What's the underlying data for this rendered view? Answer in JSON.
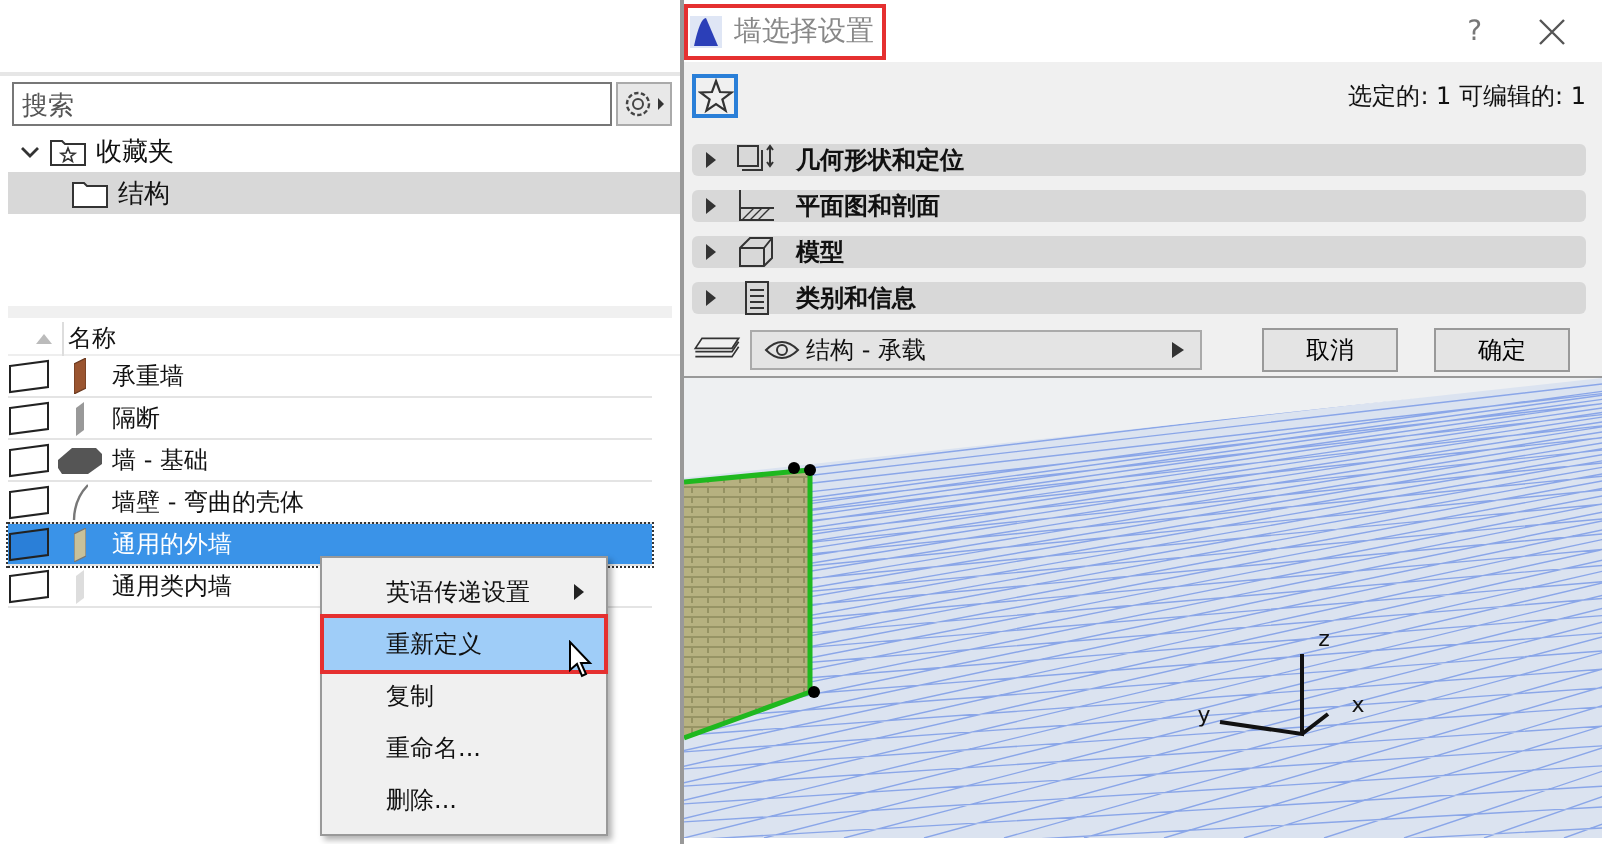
{
  "search": {
    "placeholder": "搜索"
  },
  "tree": [
    {
      "label": "收藏夹",
      "expanded": true,
      "selected": false,
      "children": [
        {
          "label": "结构",
          "selected": true
        }
      ]
    }
  ],
  "list": {
    "column": "名称",
    "rows": [
      {
        "label": "承重墙",
        "kind": "brick",
        "selected": false
      },
      {
        "label": "隔断",
        "kind": "partition",
        "selected": false
      },
      {
        "label": "墙 - 基础",
        "kind": "foundation",
        "selected": false
      },
      {
        "label": "墙壁 - 弯曲的壳体",
        "kind": "curved",
        "selected": false
      },
      {
        "label": "通用的外墙",
        "kind": "exterior",
        "selected": true
      },
      {
        "label": "通用类内墙",
        "kind": "interior",
        "selected": false
      }
    ]
  },
  "context_menu": [
    {
      "label": "英语传递设置",
      "submenu": true,
      "selected": false
    },
    {
      "label": "重新定义",
      "submenu": false,
      "selected": true
    },
    {
      "label": "复制",
      "submenu": false,
      "selected": false
    },
    {
      "label": "重命名...",
      "submenu": false,
      "selected": false
    },
    {
      "label": "删除...",
      "submenu": false,
      "selected": false
    }
  ],
  "dialog": {
    "title": "墙选择设置",
    "help": "?",
    "status": "选定的: 1 可编辑的: 1",
    "sections": [
      {
        "label": "几何形状和定位",
        "kind": "geometry",
        "expanded": false
      },
      {
        "label": "平面图和剖面",
        "kind": "plan",
        "expanded": false
      },
      {
        "label": "模型",
        "kind": "model",
        "expanded": false
      },
      {
        "label": "类别和信息",
        "kind": "info",
        "expanded": false
      }
    ],
    "view": "结构 - 承载",
    "buttons": [
      "取消",
      "确定"
    ]
  },
  "viewport": {
    "axes": [
      "z",
      "y",
      "x"
    ]
  }
}
